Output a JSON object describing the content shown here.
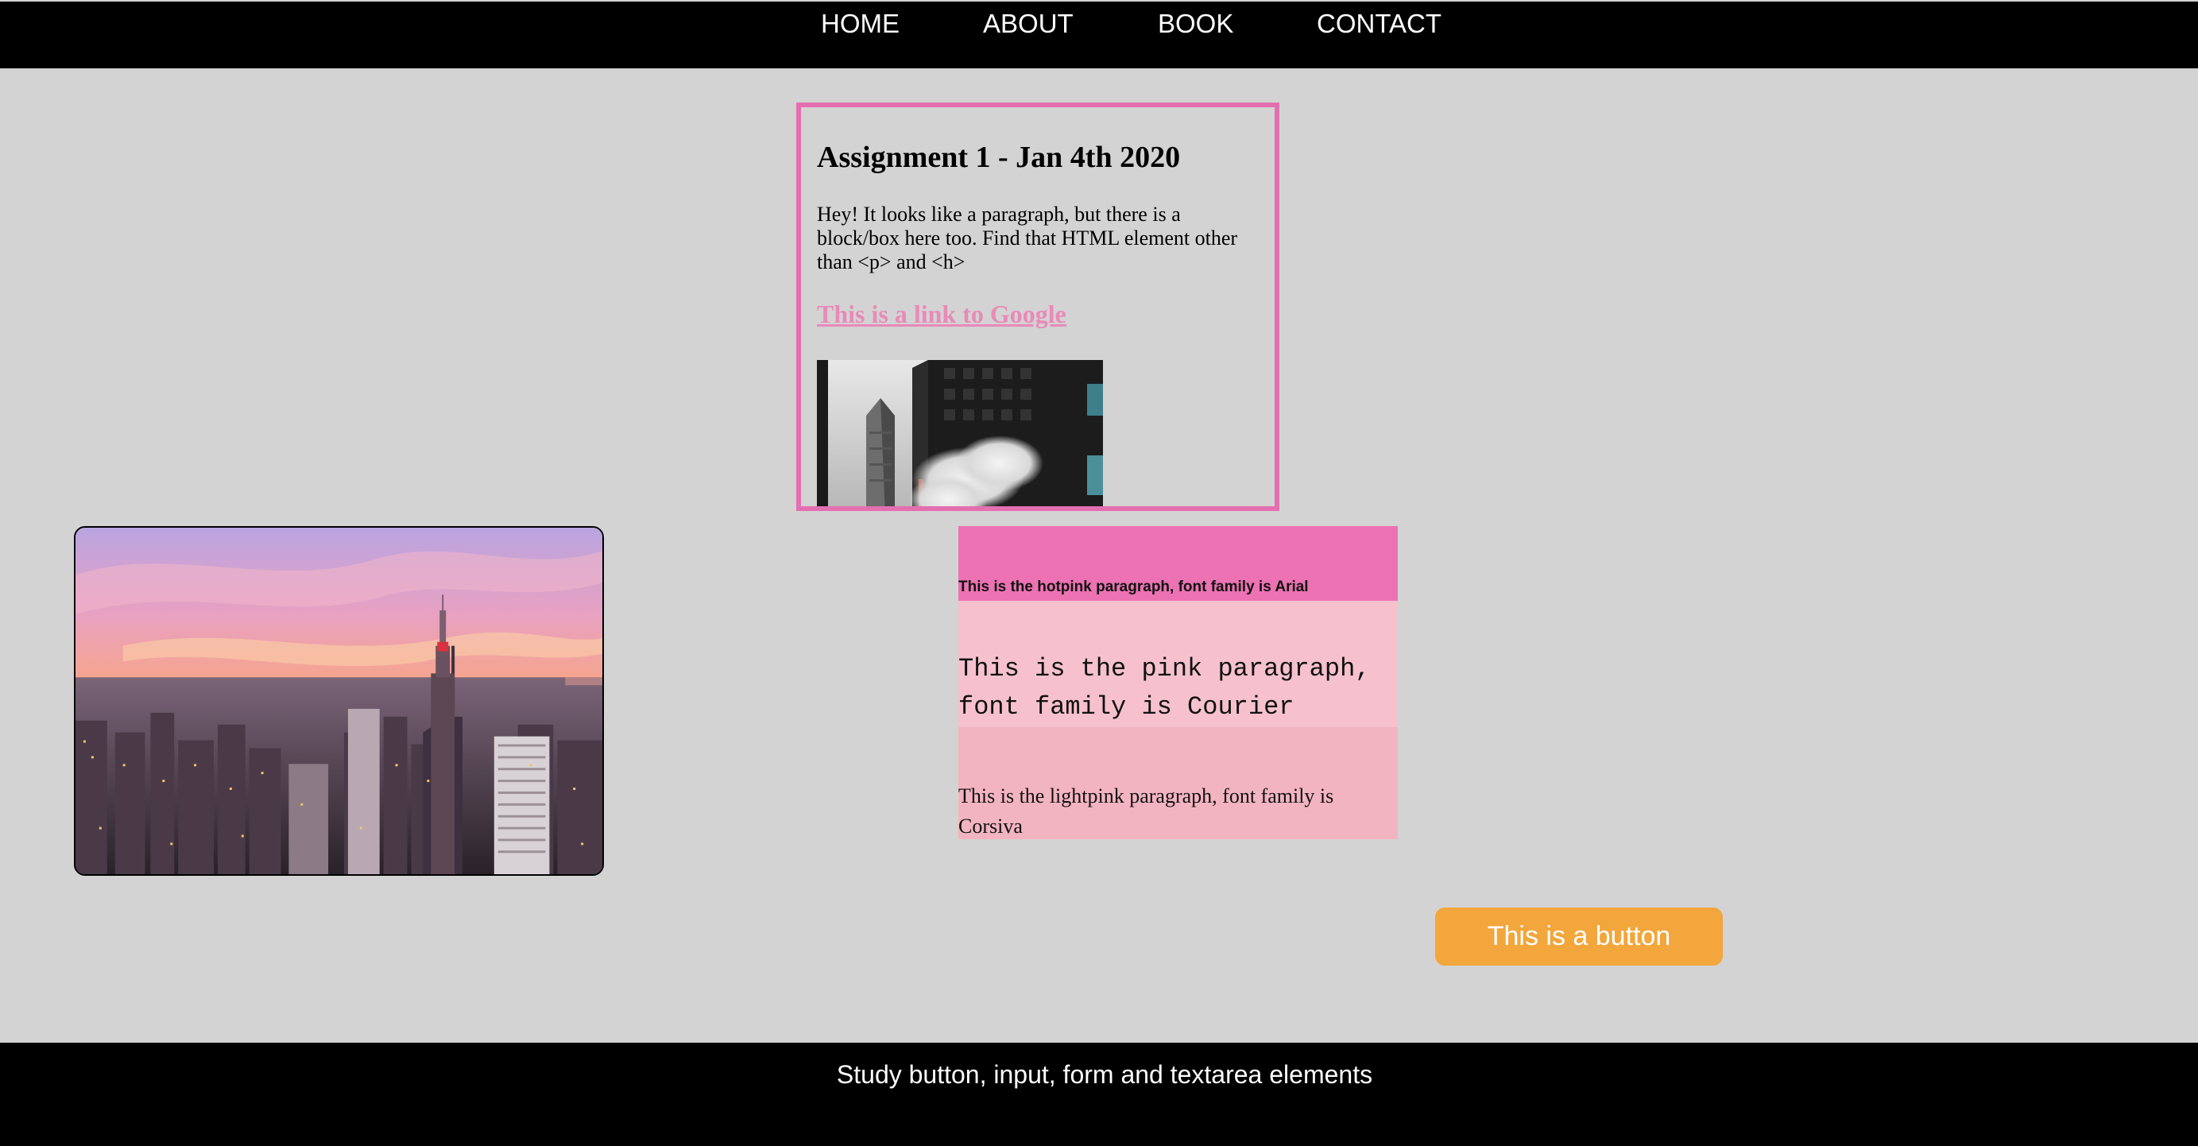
{
  "nav": {
    "items": [
      "HOME",
      "ABOUT",
      "BOOK",
      "CONTACT"
    ]
  },
  "card": {
    "title": "Assignment 1 - Jan 4th 2020",
    "paragraph": "Hey! It looks like a paragraph, but there is a block/box here too. Find that HTML element other than <p> and <h>",
    "link": "This is a link to Google",
    "link_color": "#e98ab8",
    "border_color": "#e46fb0",
    "image_icon": "city-street-photo"
  },
  "skyline_image": "new-york-skyline-sunset-photo",
  "paragraphs": {
    "hotpink": "This is the hotpink paragraph, font family is Arial",
    "pink": "This is the pink paragraph, font family is Courier",
    "lightpink": "This is the lightpink paragraph, font family is Corsiva"
  },
  "colors": {
    "hotpink": "#ec72b3",
    "pink": "#f6c1cd",
    "lightpink": "#f3b4c1",
    "button": "#f2a63c",
    "background": "#d3d3d3"
  },
  "button": {
    "label": "This is a button"
  },
  "footer": {
    "text": "Study button, input, form and textarea elements"
  }
}
